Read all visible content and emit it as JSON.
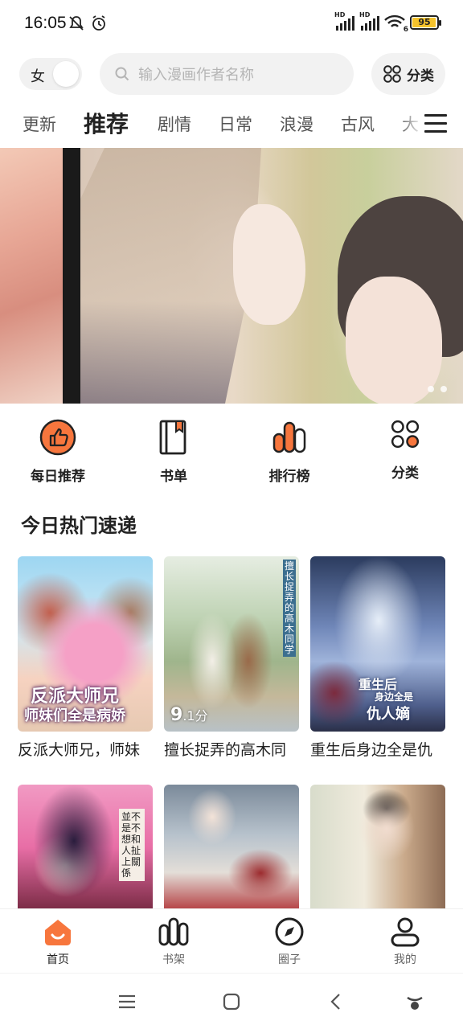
{
  "status_bar": {
    "time": "16:05",
    "battery": "95",
    "signal_label": "HD",
    "wifi_badge": "6"
  },
  "top": {
    "gender_label": "女",
    "search_placeholder": "输入漫画作者名称",
    "category_label": "分类"
  },
  "tabs": [
    "更新",
    "推荐",
    "剧情",
    "日常",
    "浪漫",
    "古风",
    "大"
  ],
  "active_tab": "推荐",
  "quick_actions": [
    {
      "label": "每日推荐",
      "icon": "thumbs-up-icon"
    },
    {
      "label": "书单",
      "icon": "book-icon"
    },
    {
      "label": "排行榜",
      "icon": "ranking-icon"
    },
    {
      "label": "分类",
      "icon": "category-grid-icon"
    }
  ],
  "section": {
    "title": "今日热门速递"
  },
  "cards_row1": [
    {
      "title": "反派大师兄，师妹",
      "cover_text_1": "反派大师兄",
      "cover_text_2": "师妹们全是病娇"
    },
    {
      "title": "擅长捉弄的高木同",
      "cover_vertical": "擅长捉弄的高木同学",
      "score_big": "9",
      "score_suffix": ".1分"
    },
    {
      "title": "重生后身边全是仇",
      "cover_text_1": "重生后",
      "cover_text_2": "身边全是",
      "cover_text_3": "仇人嫡"
    }
  ],
  "cards_row2": [
    {
      "title": "",
      "cover_text": "並不是不想和人扯上關係"
    },
    {
      "title": ""
    },
    {
      "title": ""
    }
  ],
  "bottom_nav": [
    {
      "label": "首页",
      "icon": "home-icon"
    },
    {
      "label": "书架",
      "icon": "bookshelf-icon"
    },
    {
      "label": "圈子",
      "icon": "compass-icon"
    },
    {
      "label": "我的",
      "icon": "user-icon"
    }
  ],
  "colors": {
    "accent": "#f7763d",
    "text": "#222222",
    "muted": "#666666"
  }
}
